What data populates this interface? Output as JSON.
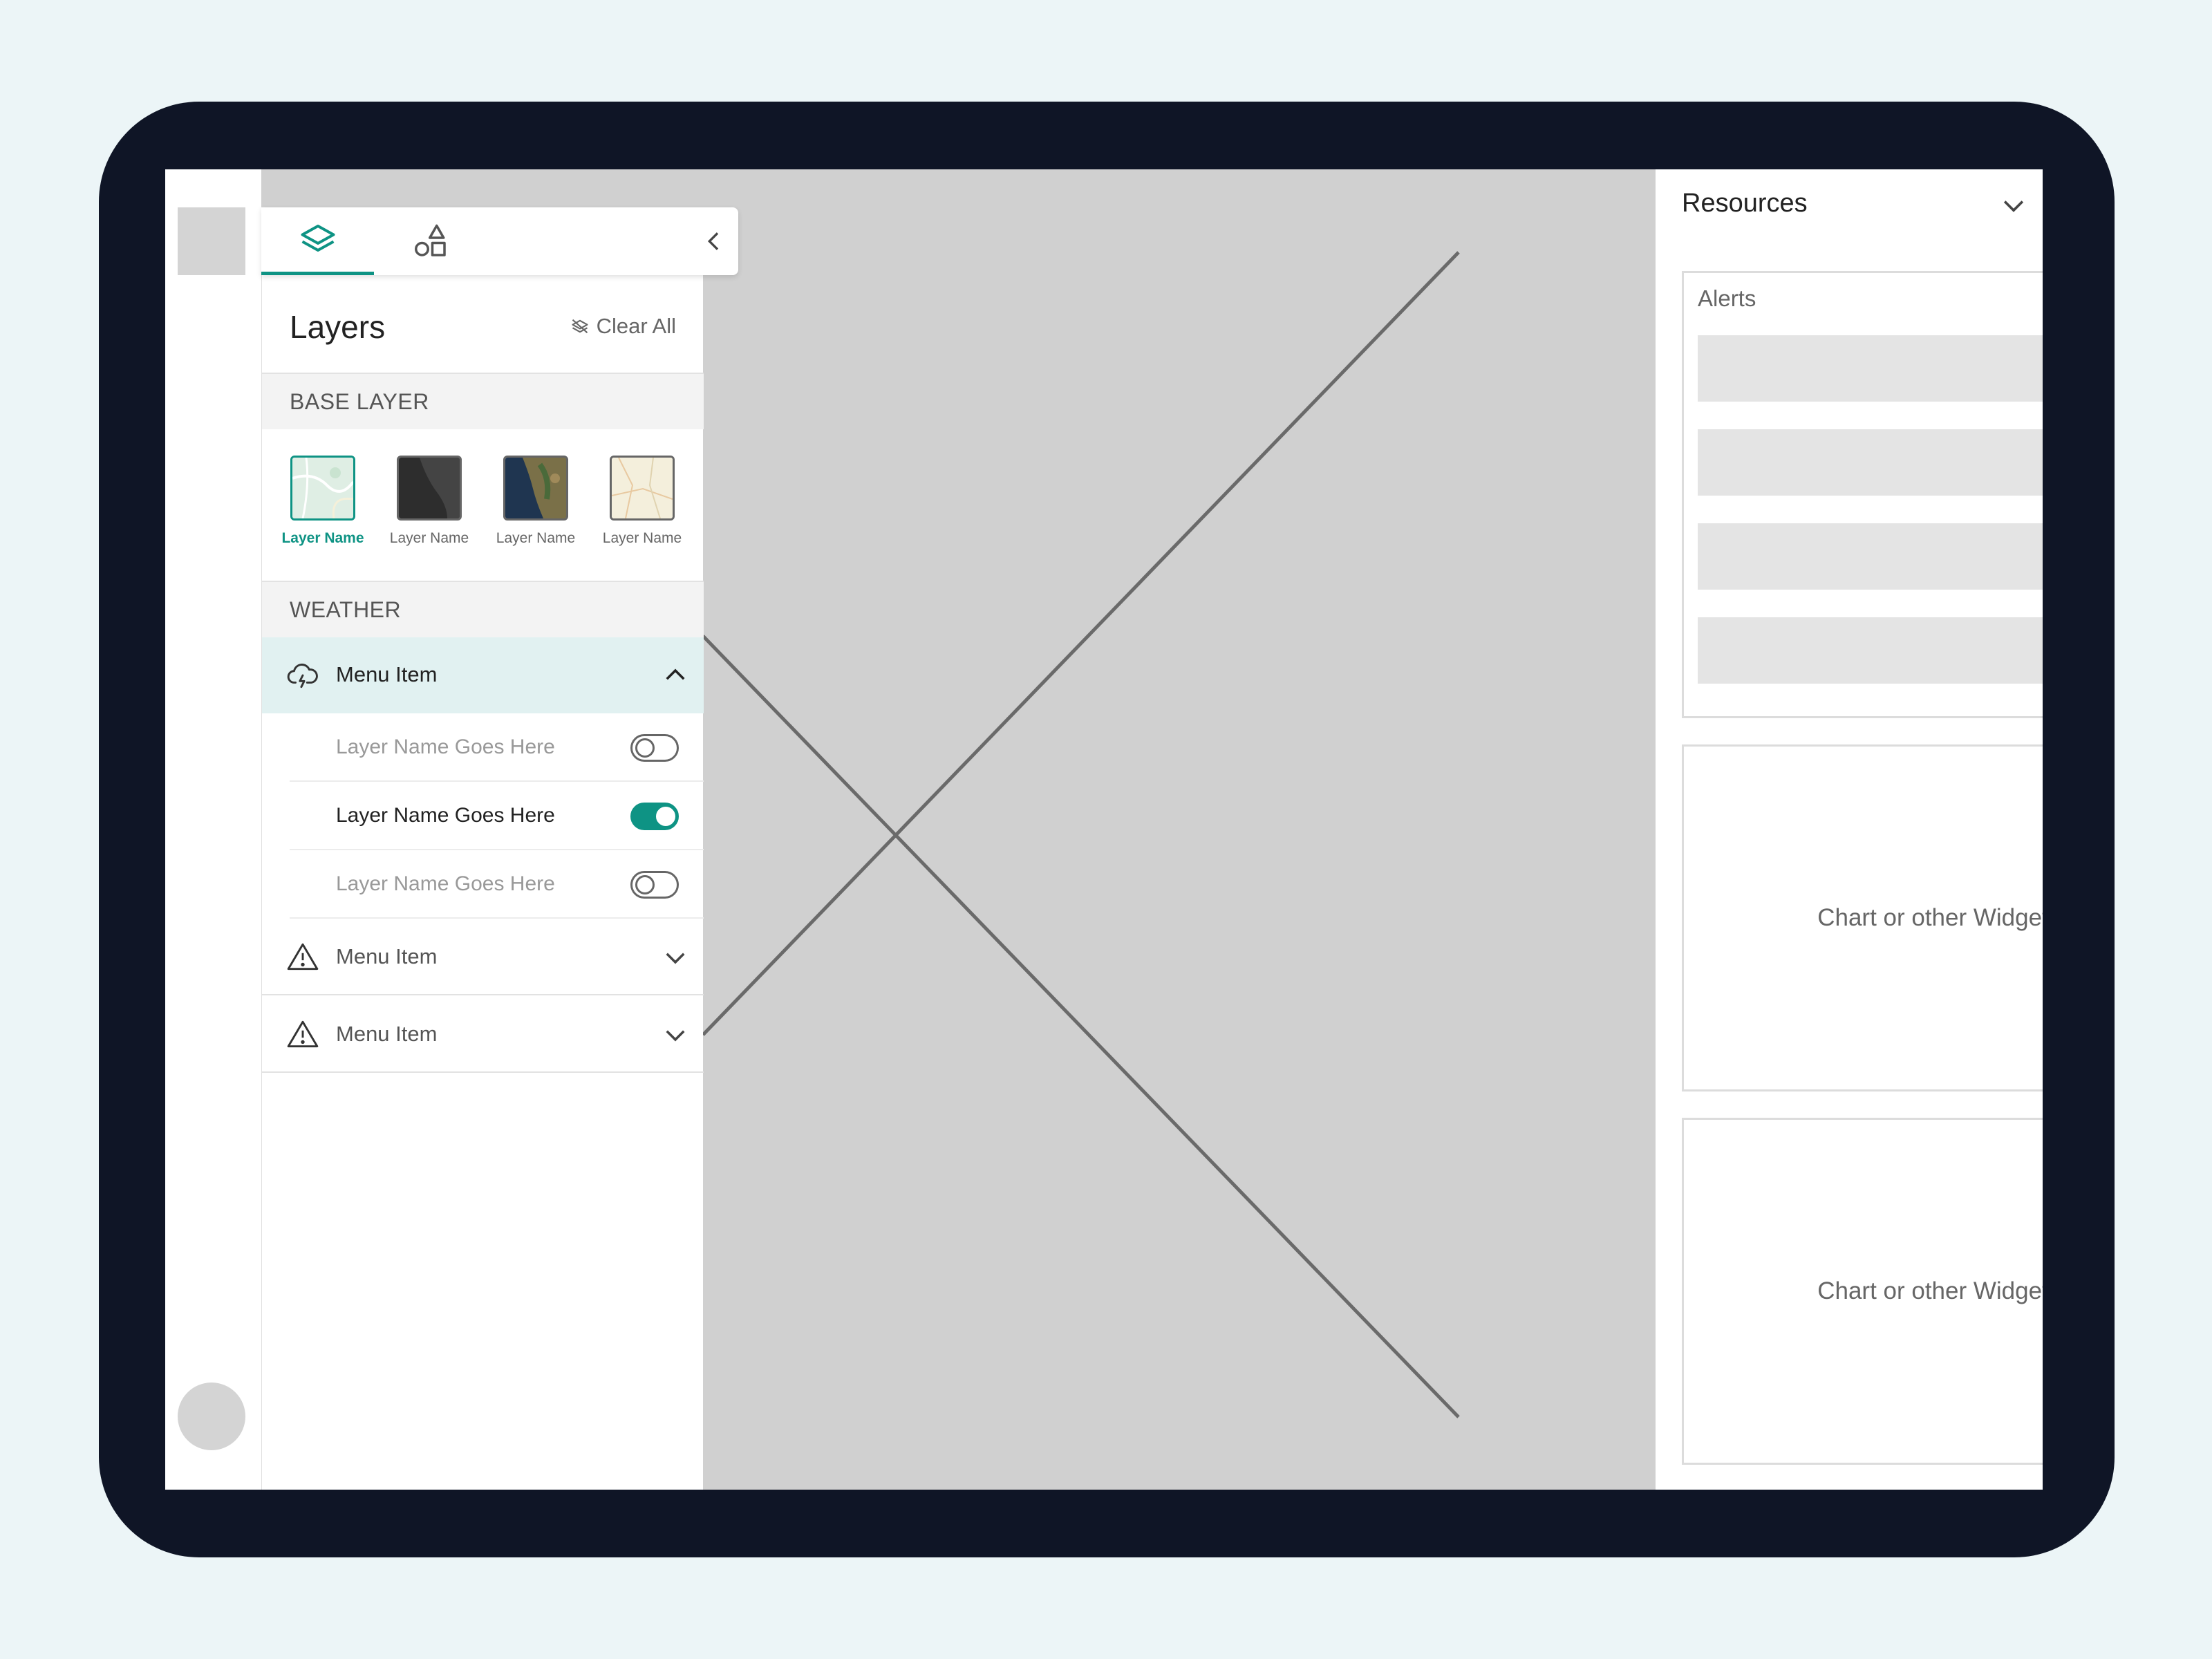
{
  "layers_panel": {
    "title": "Layers",
    "clear_all_label": "Clear All",
    "tabs": [
      {
        "icon": "layers-icon",
        "active": true
      },
      {
        "icon": "shapes-icon",
        "active": false
      }
    ],
    "collapse_icon": "chevron-left-icon",
    "base_layer": {
      "heading": "BASE LAYER",
      "items": [
        {
          "label": "Layer Name",
          "selected": true,
          "style": "light-map"
        },
        {
          "label": "Layer Name",
          "selected": false,
          "style": "dark-map"
        },
        {
          "label": "Layer Name",
          "selected": false,
          "style": "satellite-map"
        },
        {
          "label": "Layer Name",
          "selected": false,
          "style": "street-map"
        }
      ]
    },
    "weather": {
      "heading": "WEATHER",
      "menu_items": [
        {
          "label": "Menu Item",
          "icon": "cloud-lightning-icon",
          "expanded": true,
          "sublayers": [
            {
              "label": "Layer Name Goes Here",
              "on": false
            },
            {
              "label": "Layer Name Goes Here",
              "on": true
            },
            {
              "label": "Layer Name Goes Here",
              "on": false
            }
          ]
        },
        {
          "label": "Menu Item",
          "icon": "warning-icon",
          "expanded": false
        },
        {
          "label": "Menu Item",
          "icon": "warning-icon",
          "expanded": false
        }
      ]
    }
  },
  "resources": {
    "title": "Resources",
    "alerts": {
      "title": "Alerts",
      "count": 4
    },
    "widgets": [
      {
        "label": "Chart or other Widget"
      },
      {
        "label": "Chart or other Widget"
      }
    ]
  },
  "colors": {
    "accent": "#0e9384",
    "device_frame": "#0f1526",
    "background": "#ecf5f7",
    "expanded_row": "#e1f1f1",
    "map_placeholder": "#d0d0d0"
  }
}
